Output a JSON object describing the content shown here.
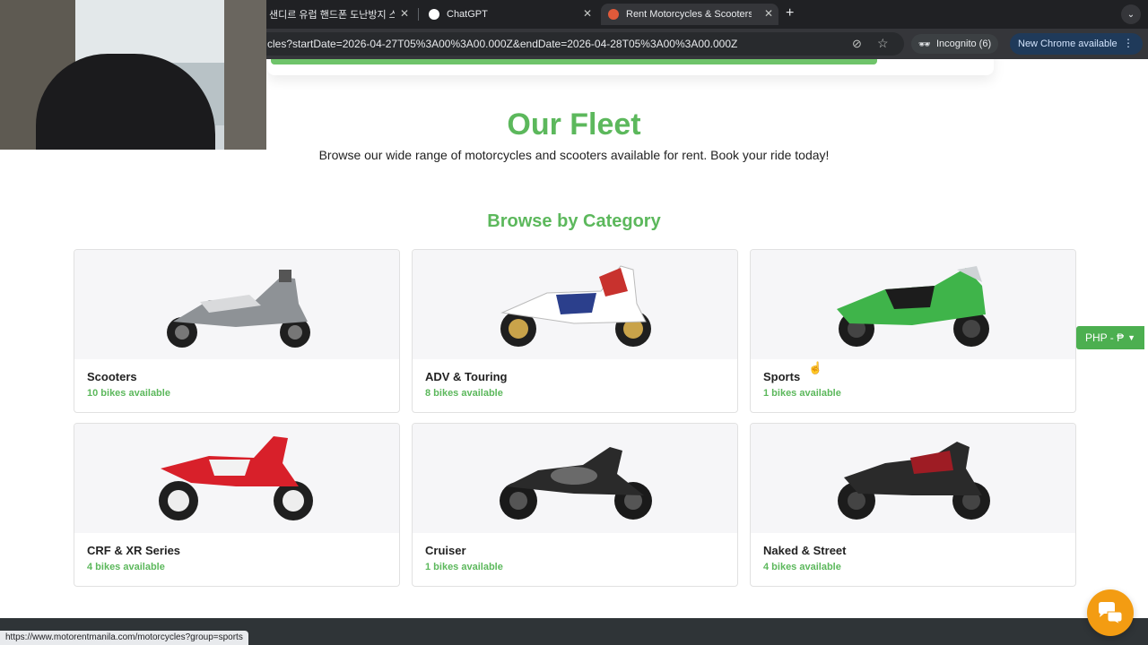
{
  "browser": {
    "tabs": [
      {
        "title": "샌디르 유럽 핸드폰 도난방지 스트랩",
        "active": false
      },
      {
        "title": "ChatGPT",
        "active": false
      },
      {
        "title": "Rent Motorcycles & Scooters",
        "active": true
      }
    ],
    "url": "cles?startDate=2026-04-27T05%3A00%3A00.000Z&endDate=2026-04-28T05%3A00%3A00.000Z",
    "incognito_label": "Incognito (6)",
    "update_label": "New Chrome available",
    "status_url": "https://www.motorentmanila.com/motorcycles?group=sports"
  },
  "page": {
    "fleet_title": "Our Fleet",
    "fleet_subtitle": "Browse our wide range of motorcycles and scooters available for rent. Book your ride today!",
    "category_title": "Browse by Category",
    "currency_label": "PHP - ₱"
  },
  "categories": [
    {
      "name": "Scooters",
      "count": "10 bikes available",
      "bike_color": "#8e9296",
      "accent": "#d9dadc"
    },
    {
      "name": "ADV & Touring",
      "count": "8 bikes available",
      "bike_color": "#ffffff",
      "accent": "#c8322e"
    },
    {
      "name": "Sports",
      "count": "1 bikes available",
      "bike_color": "#3fb44a",
      "accent": "#1c1c1c"
    },
    {
      "name": "CRF & XR Series",
      "count": "4 bikes available",
      "bike_color": "#d8202a",
      "accent": "#f2f2f2"
    },
    {
      "name": "Cruiser",
      "count": "1 bikes available",
      "bike_color": "#2a2a2a",
      "accent": "#6a6a6a"
    },
    {
      "name": "Naked & Street",
      "count": "4 bikes available",
      "bike_color": "#9e1c24",
      "accent": "#2a2a2a"
    }
  ],
  "colors": {
    "brand_green": "#5cb85c",
    "chat_orange": "#f39c12",
    "currency_green": "#4caf50"
  }
}
